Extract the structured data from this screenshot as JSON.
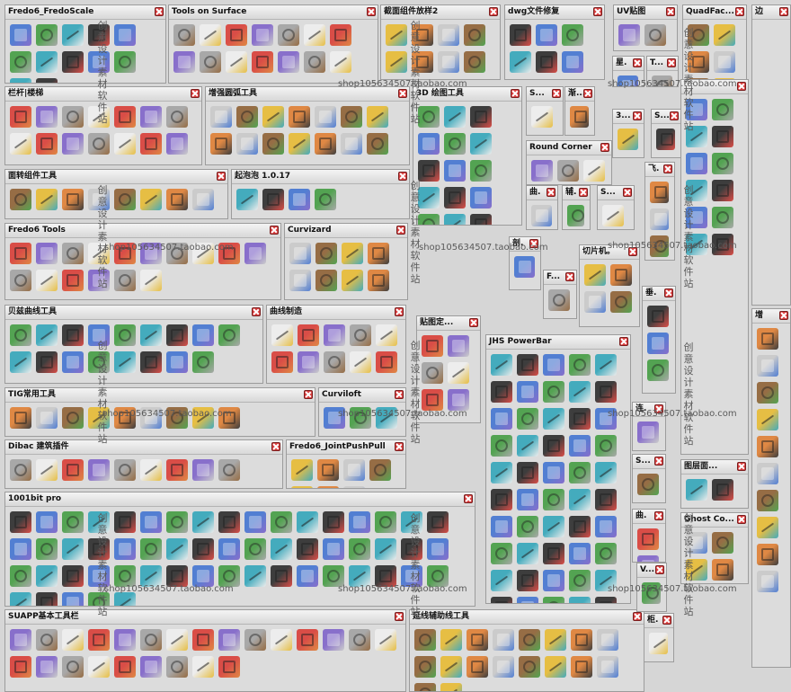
{
  "toolbars": [
    {
      "key": "fredo_scale",
      "title": "Fredo6_FredoScale",
      "n": 12
    },
    {
      "key": "tools_on_surface",
      "title": "Tools on Surface",
      "n": 14
    },
    {
      "key": "section",
      "title": "截面组件放样2",
      "n": 8
    },
    {
      "key": "dwg",
      "title": "dwg文件修复",
      "n": 6
    },
    {
      "key": "uv",
      "title": "UV贴图",
      "n": 2
    },
    {
      "key": "quadface",
      "title": "QuadFac...",
      "n": 6
    },
    {
      "key": "bian",
      "title": "边",
      "n": 0
    },
    {
      "key": "stair",
      "title": "栏杆|楼梯",
      "n": 14
    },
    {
      "key": "arc",
      "title": "增强圆弧工具",
      "n": 14
    },
    {
      "key": "draw3d",
      "title": "3D 绘图工具",
      "n": 16
    },
    {
      "key": "s1",
      "title": "S...",
      "n": 1
    },
    {
      "key": "jing",
      "title": "渐...",
      "n": 1
    },
    {
      "key": "star",
      "title": "星.",
      "n": 1
    },
    {
      "key": "t1",
      "title": "T...",
      "n": 1
    },
    {
      "key": "three",
      "title": "3...",
      "n": 1
    },
    {
      "key": "s2",
      "title": "S...",
      "n": 1
    },
    {
      "key": "roundcorner",
      "title": "Round Corner",
      "n": 3
    },
    {
      "key": "rotate",
      "title": "面转组件工具",
      "n": 8
    },
    {
      "key": "qipao",
      "title": "起泡泡 1.0.17",
      "n": 4
    },
    {
      "key": "fredo_tools",
      "title": "Fredo6 Tools",
      "n": 16
    },
    {
      "key": "curvizard",
      "title": "Curvizard",
      "n": 8
    },
    {
      "key": "bezier",
      "title": "贝兹曲线工具",
      "n": 17
    },
    {
      "key": "curvemake",
      "title": "曲线制造",
      "n": 10
    },
    {
      "key": "tig",
      "title": "TIG常用工具",
      "n": 9
    },
    {
      "key": "curviloft",
      "title": "Curviloft",
      "n": 3
    },
    {
      "key": "dibac",
      "title": "Dibac 建筑插件",
      "n": 9
    },
    {
      "key": "joint_push_pull",
      "title": "Fredo6_JointPushPull",
      "n": 7
    },
    {
      "key": "onebit",
      "title": "1001bit pro",
      "n": 56
    },
    {
      "key": "suapp",
      "title": "SUAPP基本工具栏",
      "n": 24
    },
    {
      "key": "aux_line",
      "title": "延线辅助线工具",
      "n": 18
    },
    {
      "key": "jhs",
      "title": "JHS PowerBar",
      "n": 54
    },
    {
      "key": "tietu",
      "title": "贴图定...",
      "n": 6
    },
    {
      "key": "qu",
      "title": "曲.",
      "n": 1
    },
    {
      "key": "fu",
      "title": "辅.",
      "n": 1
    },
    {
      "key": "s3",
      "title": "S...",
      "n": 1
    },
    {
      "key": "fei",
      "title": "飞.",
      "n": 4
    },
    {
      "key": "pou",
      "title": "剖.",
      "n": 1
    },
    {
      "key": "f",
      "title": "F...",
      "n": 1
    },
    {
      "key": "qiepian",
      "title": "切片机。",
      "n": 4
    },
    {
      "key": "chui",
      "title": "垂.",
      "n": 3
    },
    {
      "key": "lian",
      "title": "连.",
      "n": 1
    },
    {
      "key": "s4",
      "title": "S...",
      "n": 1
    },
    {
      "key": "layers",
      "title": "图层面...",
      "n": 2
    },
    {
      "key": "qu2",
      "title": "曲.",
      "n": 2
    },
    {
      "key": "ghost",
      "title": "Ghost Co...",
      "n": 4
    },
    {
      "key": "v",
      "title": "V...",
      "n": 1
    },
    {
      "key": "gui",
      "title": "柜.",
      "n": 1
    },
    {
      "key": "zeng",
      "title": "增",
      "n": 10
    },
    {
      "key": "misc",
      "title": "",
      "n": 12
    }
  ],
  "watermark": {
    "shop": "shop105634507.taobao.com",
    "vertical": "创意设计素材软件站"
  },
  "colors": {
    "bg": "#d6d6d6",
    "toolbar": "#dcdcdc",
    "close": "#d94040",
    "palette": [
      "#3b6fd1",
      "#d9352e",
      "#e8b92a",
      "#3c9a3a",
      "#7a5cc9",
      "#e07a2a",
      "#2aa3b8",
      "#a0a0a0",
      "#c9c9c9",
      "#222222",
      "#f0f0f0",
      "#8a5a2b"
    ]
  }
}
